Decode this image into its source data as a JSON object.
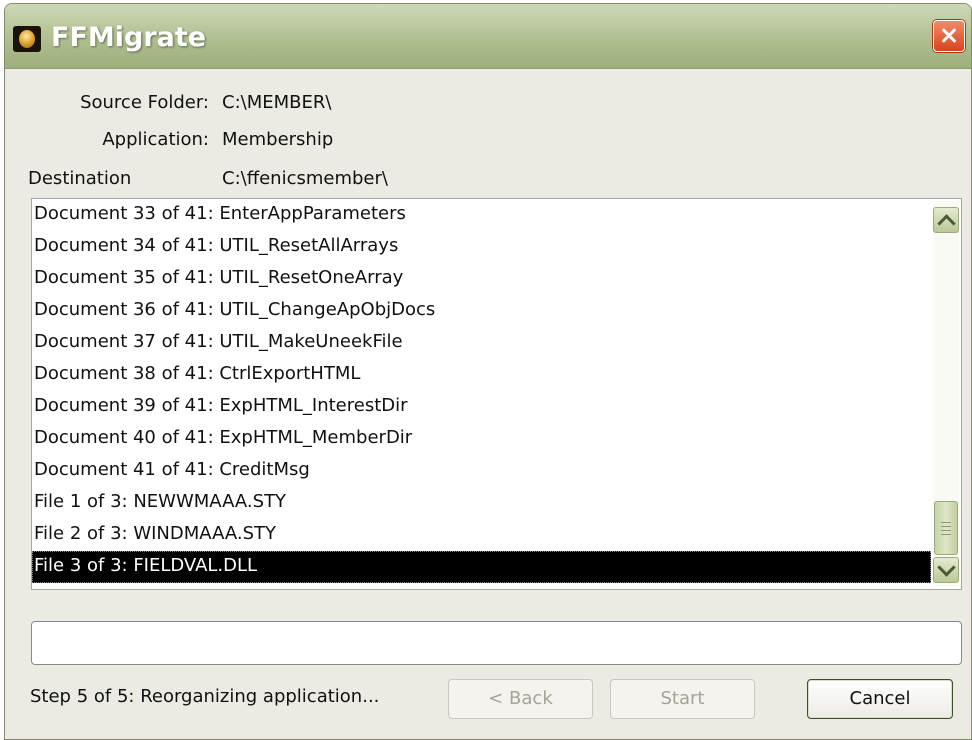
{
  "window": {
    "title": "FFMigrate",
    "close_icon": "close-icon",
    "app_icon": "app-orb-icon"
  },
  "info": {
    "source_label": "Source Folder:",
    "source_value": "C:\\MEMBER\\",
    "application_label": "Application:",
    "application_value": "Membership",
    "destination_label": "Destination",
    "destination_value": "C:\\ffenicsmember\\"
  },
  "log": {
    "items": [
      "Document 33 of 41: EnterAppParameters",
      "Document 34 of 41: UTIL_ResetAllArrays",
      "Document 35 of 41: UTIL_ResetOneArray",
      "Document 36 of 41: UTIL_ChangeApObjDocs",
      "Document 37 of 41: UTIL_MakeUneekFile",
      "Document 38 of 41: CtrlExportHTML",
      "Document 39 of 41: ExpHTML_InterestDir",
      "Document 40 of 41: ExpHTML_MemberDir",
      "Document 41 of 41: CreditMsg",
      "File 1 of 3: NEWWMAAA.STY",
      "File 2 of 3: WINDMAAA.STY",
      "File 3 of 3: FIELDVAL.DLL"
    ],
    "selected": "File 3 of 3: FIELDVAL.DLL"
  },
  "progress": {
    "value": 0
  },
  "status": "Step 5 of 5: Reorganizing application...",
  "buttons": {
    "back": "< Back",
    "start": "Start",
    "cancel": "Cancel"
  },
  "colors": {
    "titlebar": "#a9b98a",
    "window_bg": "#ecebe3",
    "selection": "#000000",
    "close_button": "#d9431d"
  }
}
